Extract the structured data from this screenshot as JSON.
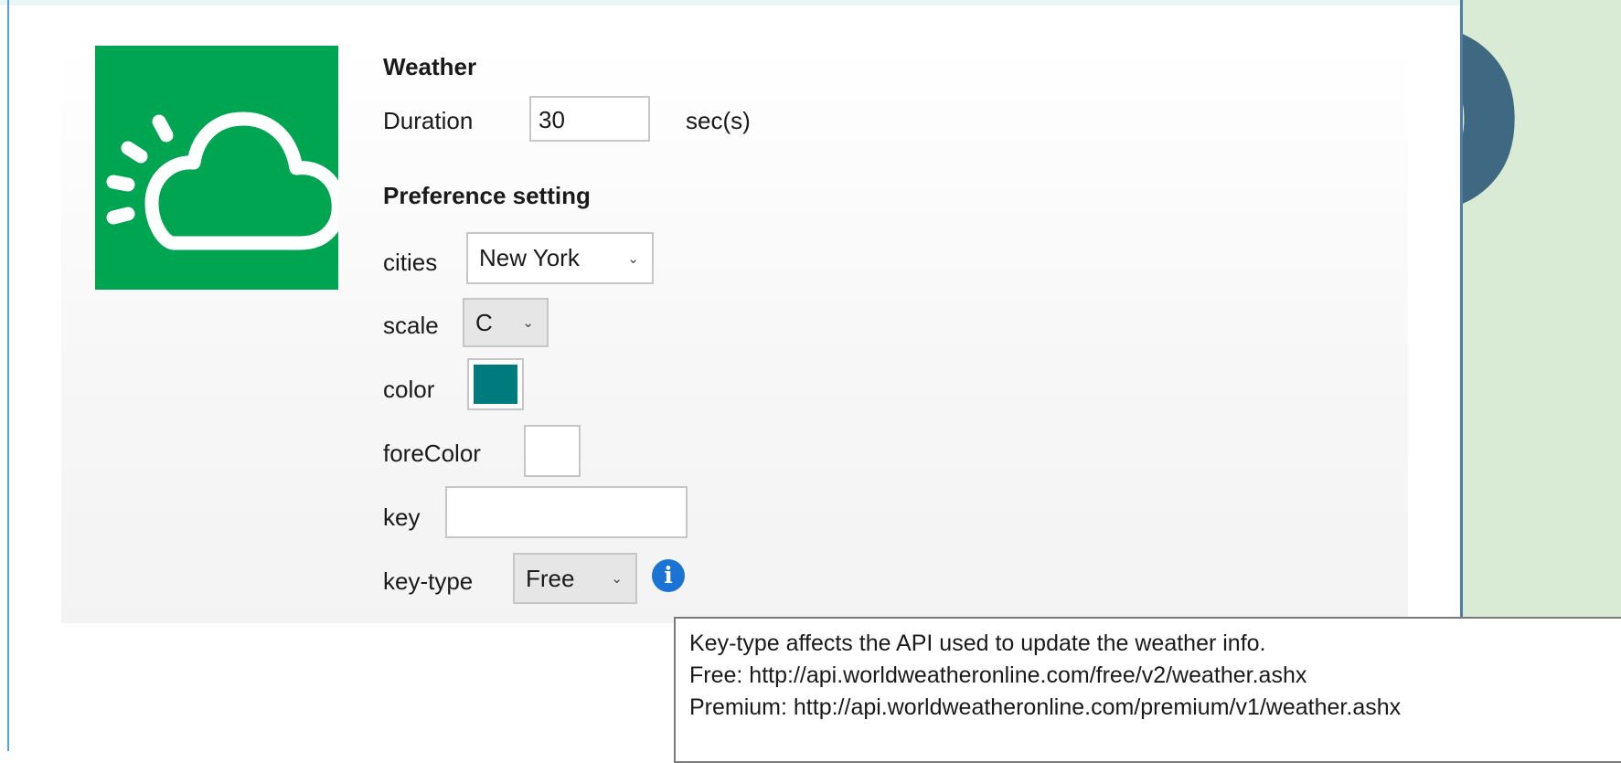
{
  "widget": {
    "title": "Weather",
    "duration_label": "Duration",
    "duration_value": "30",
    "duration_unit": "sec(s)",
    "preference_heading": "Preference setting",
    "icon_color": "#00a552"
  },
  "preferences": {
    "cities_label": "cities",
    "cities_value": "New York",
    "scale_label": "scale",
    "scale_value": "C",
    "color_label": "color",
    "color_value": "#007b7d",
    "forecolor_label": "foreColor",
    "forecolor_value": "#ffffff",
    "key_label": "key",
    "key_value": "",
    "keytype_label": "key-type",
    "keytype_value": "Free",
    "info_icon": "info-icon"
  },
  "tooltip": {
    "line1": "Key-type affects the API used to update the weather info.",
    "line2": "Free: http://api.worldweatheronline.com/free/v2/weather.ashx",
    "line3": "Premium: http://api.worldweatheronline.com/premium/v1/weather.ashx"
  },
  "background": {
    "letter": "D",
    "panel_color": "#d9ead5"
  }
}
